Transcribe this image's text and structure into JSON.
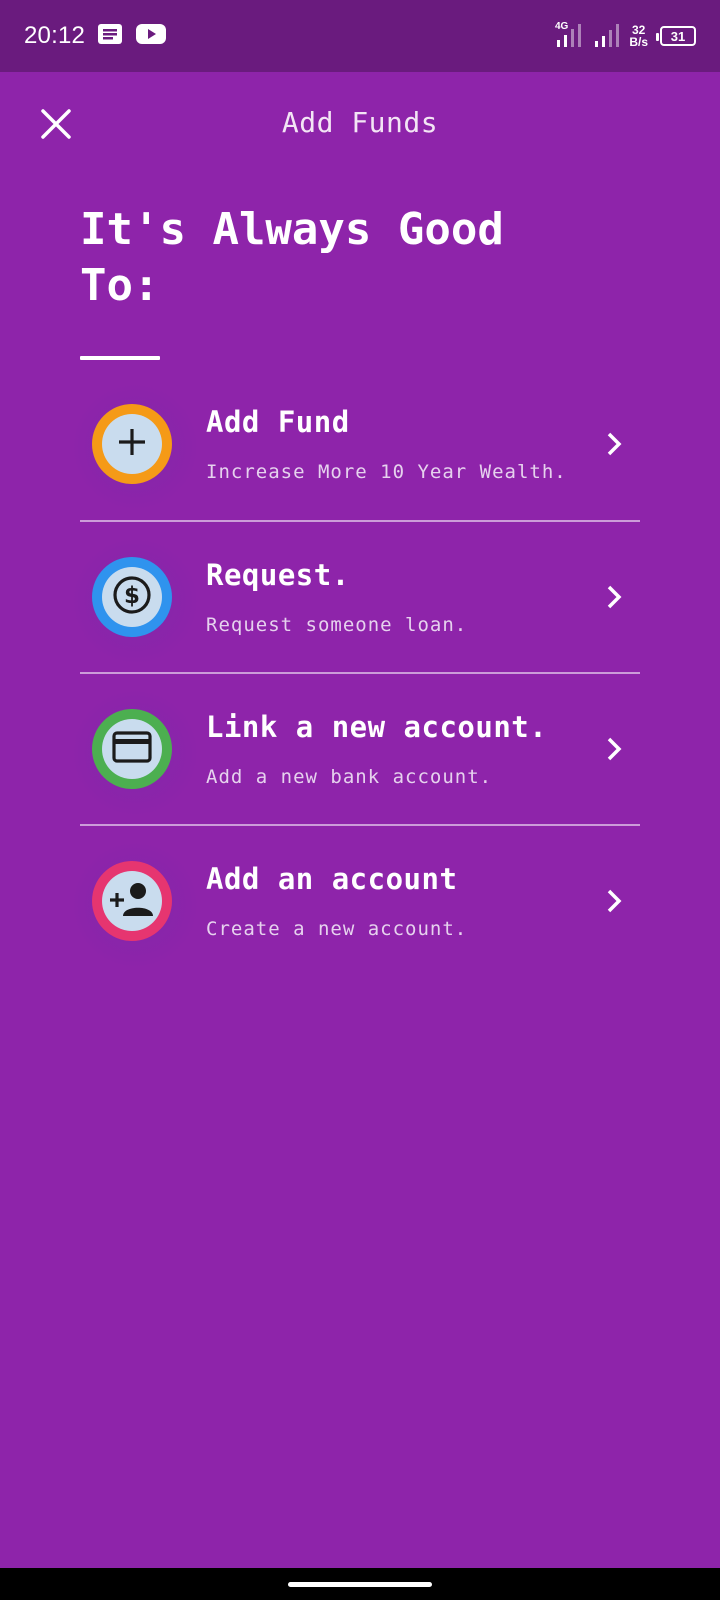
{
  "status_bar": {
    "time": "20:12",
    "icons_left": [
      "message-icon",
      "youtube-icon"
    ],
    "net_speed_value": "32",
    "net_speed_unit": "B/s",
    "network_label": "4G",
    "battery": "31"
  },
  "header": {
    "title": "Add Funds",
    "close_icon": "close-icon"
  },
  "headline": {
    "line1": "It's Always Good",
    "line2": "To:"
  },
  "menu": {
    "items": [
      {
        "title": "Add Fund",
        "subtitle": "Increase More 10 Year Wealth.",
        "icon": "plus-icon",
        "ring_color": "#f59a17"
      },
      {
        "title": "Request.",
        "subtitle": "Request someone loan.",
        "icon": "dollar-icon",
        "ring_color": "#2f93ee"
      },
      {
        "title": "Link a new account.",
        "subtitle": "Add a new bank account.",
        "icon": "credit-card-icon",
        "ring_color": "#4caf50"
      },
      {
        "title": "Add an account",
        "subtitle": "Create a new account.",
        "icon": "add-person-icon",
        "ring_color": "#e63570"
      }
    ]
  },
  "colors": {
    "background": "#8e24aa",
    "status_bar": "#6a1b7e"
  }
}
